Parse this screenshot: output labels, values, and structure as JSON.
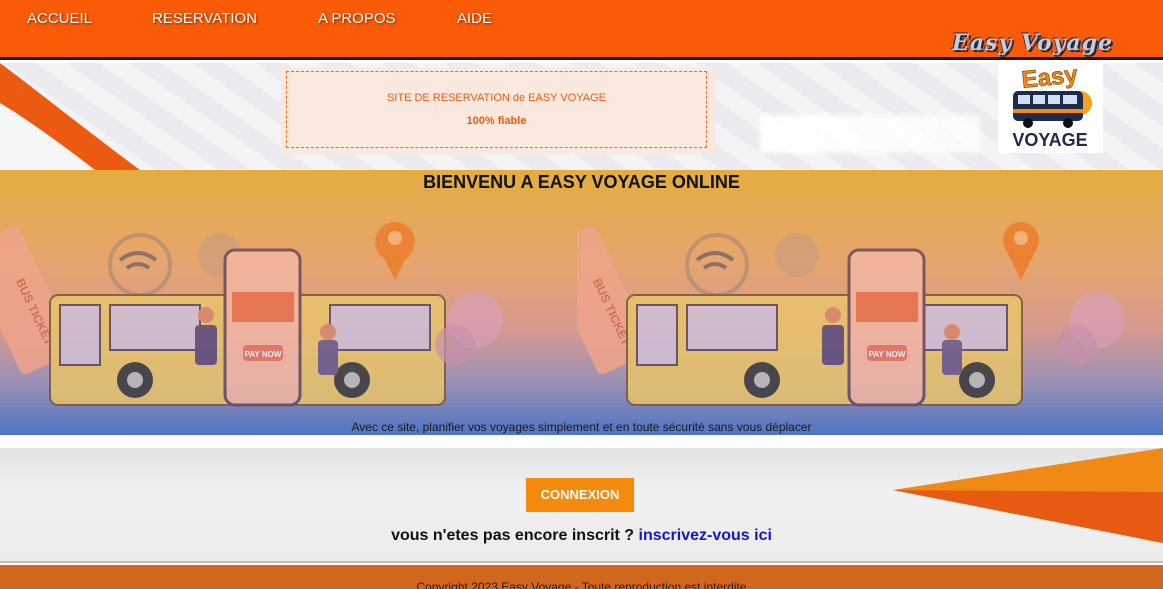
{
  "nav": {
    "items": [
      "ACCUEIL",
      "RESERVATION",
      "A PROPOS",
      "AIDE"
    ],
    "brand": "Easy Voyage"
  },
  "notice": {
    "line1": "SITE DE RESERVATION de EASY VOYAGE",
    "line2": "100% fiable"
  },
  "logo": {
    "word1": "Easy",
    "word2": "VOYAGE"
  },
  "hero": {
    "title": "BIENVENU A EASY VOYAGE ONLINE",
    "subtitle": "Avec ce site, planifier vos voyages simplement et en toute sécurité sans vous déplacer",
    "illustration": {
      "ticket_text": "BUS TICKET",
      "pay_button": "PAY NOW"
    }
  },
  "connect": {
    "button_label": "CONNEXION",
    "register_prompt": "vous n'etes pas encore inscrit ?",
    "register_link": "inscrivez-vous ici"
  },
  "footer": {
    "text": "Copyright 2023 Easy Voyage - Toute reproduction est interdite"
  },
  "colors": {
    "nav_bg": "#fb5a06",
    "accent_orange": "#f58a0c",
    "link_blue": "#1515c9",
    "footer_bg": "#d2661c"
  }
}
